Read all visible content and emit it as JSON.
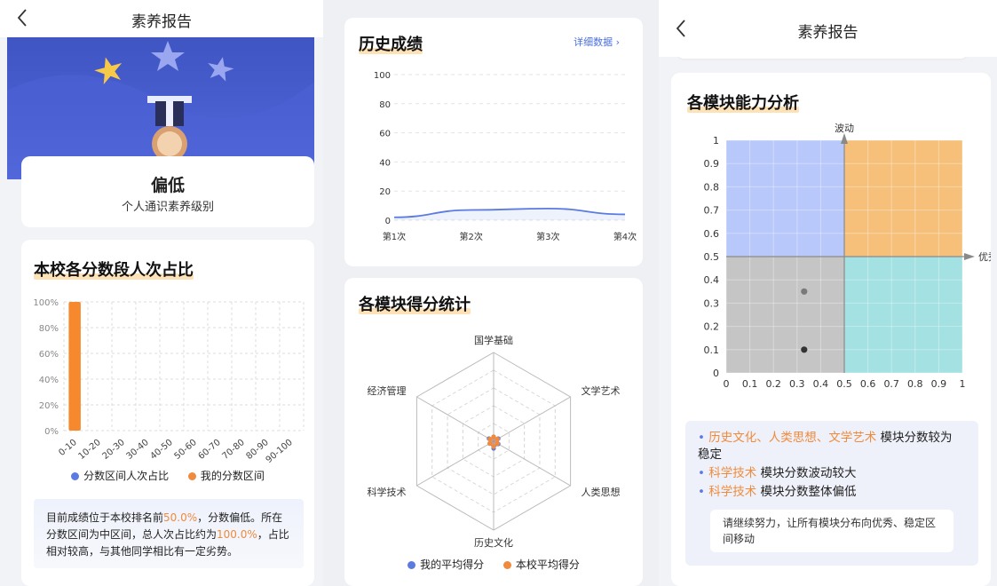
{
  "nav": {
    "title": "素养报告"
  },
  "level": {
    "value": "偏低",
    "subtitle": "个人通识素养级别"
  },
  "dist": {
    "title": "本校各分数段人次占比",
    "legend": [
      "分数区间人次占比",
      "我的分数区间"
    ],
    "summary": {
      "p1": "目前成绩位于本校排名前",
      "rank": "50.0%",
      "p2": "，分数偏低。所在分数区间为中区间，总人次占比约为",
      "ratio": "100.0%",
      "p3": "，占比相对较高，与其他同学相比有一定劣势。"
    }
  },
  "history": {
    "title": "历史成绩",
    "detail_link": "详细数据 ›"
  },
  "modules": {
    "title": "各模块得分统计",
    "legend": [
      "我的平均得分",
      "本校平均得分"
    ]
  },
  "ability": {
    "title": "各模块能力分析",
    "axis_y_name": "波动",
    "axis_x_name": "优秀",
    "points": [
      {
        "x": 0.33,
        "y": 0.35
      },
      {
        "x": 0.33,
        "y": 0.1
      }
    ],
    "notes": [
      {
        "hl": "历史文化、人类思想、文学艺术",
        "text": " 模块分数较为稳定"
      },
      {
        "hl": "科学技术",
        "text": " 模块分数波动较大"
      },
      {
        "hl": "科学技术",
        "text": " 模块分数整体偏低"
      }
    ],
    "advice": "请继续努力，让所有模块分布向优秀、稳定区间移动"
  },
  "colors": {
    "accent": "#f08a3c",
    "blue": "#5b7be0",
    "bar": "#f6892e"
  },
  "chart_data": [
    {
      "type": "bar",
      "categories": [
        "0-10",
        "10-20",
        "20-30",
        "30-40",
        "40-50",
        "50-60",
        "60-70",
        "70-80",
        "80-90",
        "90-100"
      ],
      "series": [
        {
          "name": "分数区间人次占比",
          "values": [
            100,
            0,
            0,
            0,
            0,
            0,
            0,
            0,
            0,
            0
          ]
        },
        {
          "name": "我的分数区间",
          "values": [
            100,
            0,
            0,
            0,
            0,
            0,
            0,
            0,
            0,
            0
          ]
        }
      ],
      "ytick_labels": [
        "0%",
        "20%",
        "40%",
        "60%",
        "80%",
        "100%"
      ],
      "ylim": [
        0,
        100
      ],
      "grid": true,
      "legend": "bottom"
    },
    {
      "type": "line",
      "title": "历史成绩",
      "categories": [
        "第1次",
        "第2次",
        "第3次",
        "第4次"
      ],
      "series": [
        {
          "values": [
            2,
            7,
            8,
            4
          ]
        }
      ],
      "yticks": [
        0,
        20,
        40,
        60,
        80,
        100
      ],
      "ylim": [
        0,
        100
      ],
      "grid": true
    },
    {
      "type": "radar",
      "title": "各模块得分统计",
      "axes": [
        "国学基础",
        "文学艺术",
        "人类思想",
        "历史文化",
        "科学技术",
        "经济管理"
      ],
      "max": 100,
      "series": [
        {
          "name": "我的平均得分",
          "values": [
            5,
            6,
            6,
            8,
            5,
            6
          ]
        },
        {
          "name": "本校平均得分",
          "values": [
            5,
            5,
            5,
            6,
            5,
            5
          ]
        }
      ],
      "legend": "bottom"
    },
    {
      "type": "scatter",
      "title": "各模块能力分析",
      "xticks": [
        0,
        0.1,
        0.2,
        0.3,
        0.4,
        0.5,
        0.6,
        0.7,
        0.8,
        0.9,
        1
      ],
      "yticks": [
        0,
        0.1,
        0.2,
        0.3,
        0.4,
        0.5,
        0.6,
        0.7,
        0.8,
        0.9,
        1
      ],
      "xlim": [
        0,
        1
      ],
      "ylim": [
        0,
        1
      ],
      "points": [
        {
          "x": 0.33,
          "y": 0.35
        },
        {
          "x": 0.33,
          "y": 0.1
        }
      ],
      "xlabel": "优秀",
      "ylabel": "波动"
    }
  ]
}
